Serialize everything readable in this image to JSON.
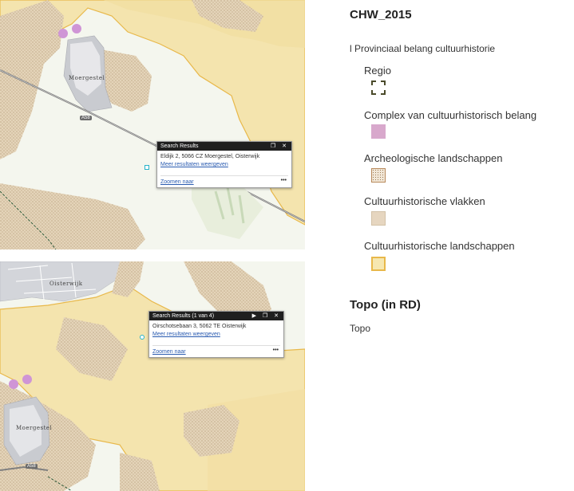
{
  "top_map": {
    "town_label": "Moergestel",
    "road_label": "A58",
    "popup": {
      "title": "Search Results",
      "controls": "❐ ✕",
      "address": "Eldijk 2, 5066 CZ Moergestel, Oisterwijk",
      "more_link": "Meer resultaten weergeven",
      "zoom_link": "Zoomen naar",
      "more_icon": "•••"
    }
  },
  "bottom_map": {
    "town_label_1": "Oisterwijk",
    "town_label_2": "Moergestel",
    "road_label": "A58",
    "popup": {
      "title": "Search Results (1 van 4)",
      "controls": "▶ ❐ ✕",
      "address": "Oirschotsebaan 3, 5062 TE Oisterwijk",
      "more_link": "Meer resultaten weergeven",
      "zoom_link": "Zoomen naar",
      "more_icon": "•••"
    }
  },
  "legend": {
    "layer_title": "CHW_2015",
    "group_title": "l Provinciaal belang cultuurhistorie",
    "items": [
      {
        "label": "Regio",
        "icon": "dashed-square",
        "color": "#4a4a2a"
      },
      {
        "label": "Complex van cultuurhistorisch belang",
        "icon": "filled-square",
        "color": "#d8a8cc"
      },
      {
        "label": "Archeologische landschappen",
        "icon": "dotted-square",
        "color": "#b8895a"
      },
      {
        "label": "Cultuurhistorische vlakken",
        "icon": "filled-square",
        "color": "#e6d6c0"
      },
      {
        "label": "Cultuurhistorische landschappen",
        "icon": "filled-square",
        "color": "#f6e7b0"
      }
    ],
    "layer2_title": "Topo (in RD)",
    "layer2_sub": "Topo"
  },
  "colors": {
    "landscape_fill": "#f4e4ae",
    "landscape_border": "#e8b84a",
    "vlakken_fill": "#e2d3bb",
    "complex_fill": "#cf95d6",
    "base_map": "#f4f6ee",
    "urban": "#c9cbd0"
  }
}
